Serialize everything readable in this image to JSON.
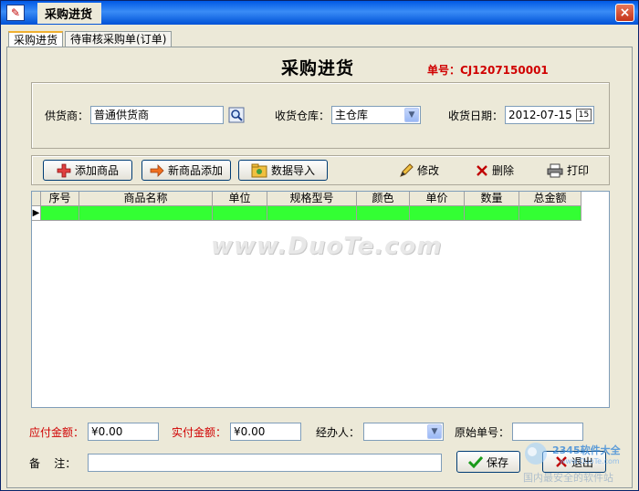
{
  "window": {
    "title": "采购进货",
    "close": "×"
  },
  "tabs": [
    {
      "label": "采购进货",
      "active": true
    },
    {
      "label": "待审核采购单(订单)",
      "active": false
    }
  ],
  "heading": "采购进货",
  "order_no": "单号：CJ1207150001",
  "form": {
    "supplier_label": "供货商：",
    "supplier_value": "普通供货商",
    "warehouse_label": "收货仓库：",
    "warehouse_value": "主仓库",
    "date_label": "收货日期：",
    "date_value": "2012-07-15",
    "date_button": "15"
  },
  "toolbar": {
    "add_product": "添加商品",
    "new_product_add": "新商品添加",
    "import_data": "数据导入",
    "edit": "修改",
    "delete": "删除",
    "print": "打印"
  },
  "grid": {
    "columns": [
      "序号",
      "商品名称",
      "单位",
      "规格型号",
      "颜色",
      "单价",
      "数量",
      "总金额"
    ],
    "row_marker": "▶"
  },
  "watermark": "www.DuoTe.com",
  "footer": {
    "payable_label": "应付金额：",
    "payable_value": "¥0.00",
    "actual_label": "实付金额：",
    "actual_value": "¥0.00",
    "handler_label": "经办人：",
    "handler_value": "",
    "original_no_label": "原始单号：",
    "original_no_value": "",
    "remark_label": "备    注：",
    "remark_value": "",
    "save": "保存",
    "exit": "退出"
  },
  "corner_logo": {
    "brand": "2345软件大全",
    "site": "www.DuoTe.com",
    "tagline": "国内最安全的软件站"
  },
  "colors": {
    "title_bar": "#0058e6",
    "row_highlight": "#33ff33",
    "accent_red": "#d00000",
    "face": "#ece9d8"
  }
}
